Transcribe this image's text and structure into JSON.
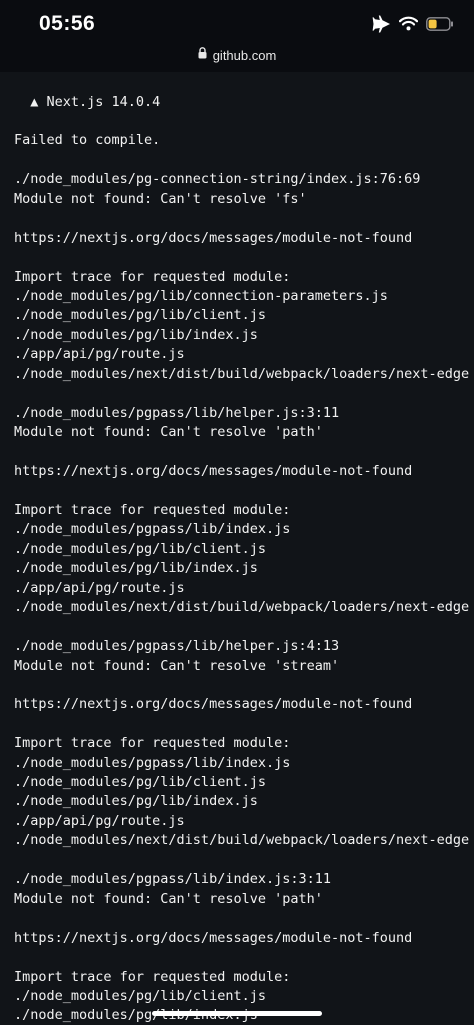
{
  "status_bar": {
    "time": "05:56",
    "icons": [
      "airplane-icon",
      "wifi-icon",
      "battery-icon"
    ],
    "battery_color": "#f5c542"
  },
  "url_bar": {
    "domain": "github.com",
    "icon": "lock-icon"
  },
  "terminal": {
    "lines": [
      "  ▲ Next.js 14.0.4",
      "Failed to compile.",
      "./node_modules/pg-connection-string/index.js:76:69",
      "Module not found: Can't resolve 'fs'",
      "https://nextjs.org/docs/messages/module-not-found",
      "Import trace for requested module:",
      "./node_modules/pg/lib/connection-parameters.js",
      "./node_modules/pg/lib/client.js",
      "./node_modules/pg/lib/index.js",
      "./app/api/pg/route.js",
      "./node_modules/next/dist/build/webpack/loaders/next-edge",
      "./node_modules/pgpass/lib/helper.js:3:11",
      "Module not found: Can't resolve 'path'",
      "https://nextjs.org/docs/messages/module-not-found",
      "Import trace for requested module:",
      "./node_modules/pgpass/lib/index.js",
      "./node_modules/pg/lib/client.js",
      "./node_modules/pg/lib/index.js",
      "./app/api/pg/route.js",
      "./node_modules/next/dist/build/webpack/loaders/next-edge",
      "./node_modules/pgpass/lib/helper.js:4:13",
      "Module not found: Can't resolve 'stream'",
      "https://nextjs.org/docs/messages/module-not-found",
      "Import trace for requested module:",
      "./node_modules/pgpass/lib/index.js",
      "./node_modules/pg/lib/client.js",
      "./node_modules/pg/lib/index.js",
      "./app/api/pg/route.js",
      "./node_modules/next/dist/build/webpack/loaders/next-edge",
      "./node_modules/pgpass/lib/index.js:3:11",
      "Module not found: Can't resolve 'path'",
      "https://nextjs.org/docs/messages/module-not-found",
      "Import trace for requested module:",
      "./node_modules/pg/lib/client.js",
      "./node_modules/pg/lib/index.js"
    ]
  }
}
